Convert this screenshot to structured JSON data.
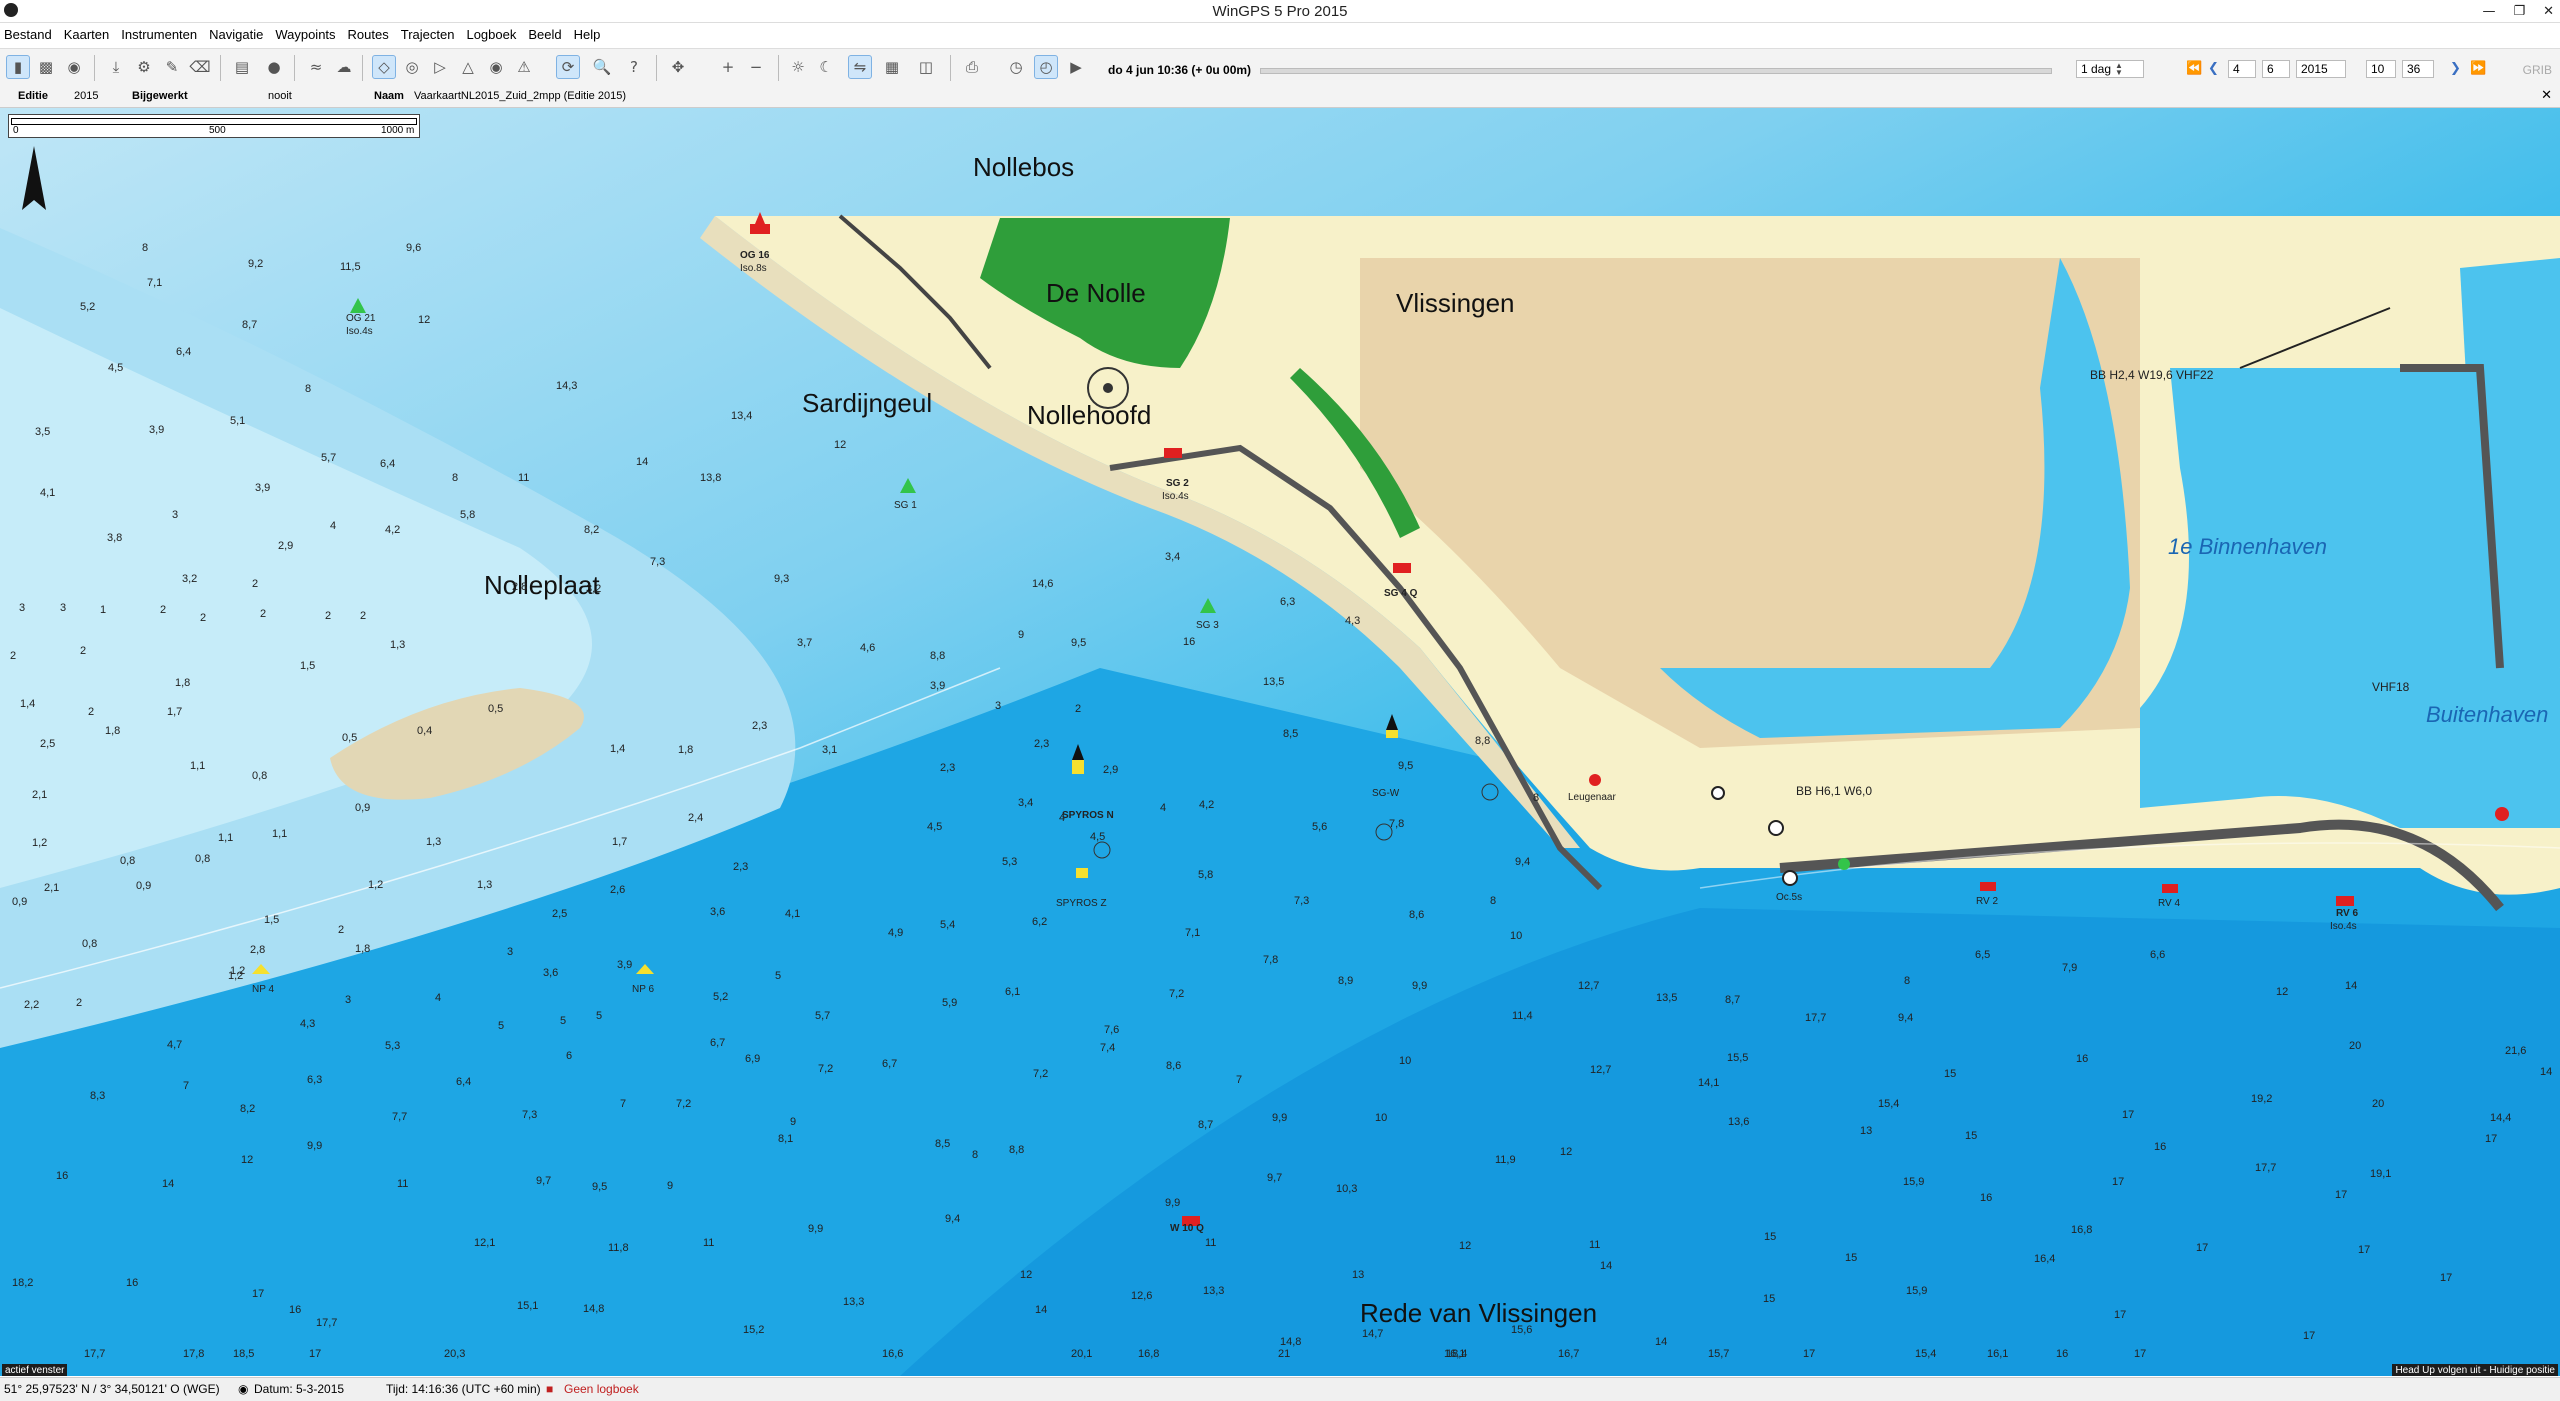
{
  "window": {
    "title": "WinGPS 5 Pro 2015"
  },
  "menu": [
    "Bestand",
    "Kaarten",
    "Instrumenten",
    "Navigatie",
    "Waypoints",
    "Routes",
    "Trajecten",
    "Logboek",
    "Beeld",
    "Help"
  ],
  "toolbar": {
    "datetime_label": "do 4 jun 10:36 (+ 0u 00m)",
    "step": "1 dag",
    "day": "4",
    "month": "6",
    "year": "2015",
    "hour": "10",
    "minute": "36",
    "grib": "GRIB"
  },
  "chartinfo": {
    "edition_label": "Editie",
    "edition": "2015",
    "updated_label": "Bijgewerkt",
    "updated": "nooit",
    "name_label": "Naam",
    "name": "VaarkaartNL2015_Zuid_2mpp (Editie 2015)"
  },
  "map": {
    "scale": {
      "s0": "0",
      "s1": "500",
      "s2": "1000 m"
    },
    "places": {
      "nollebos": "Nollebos",
      "denolle": "De Nolle",
      "vlissingen": "Vlissingen",
      "sardijngeul": "Sardijngeul",
      "nollehoofd": "Nollehoofd",
      "nolleplaat": "Nolleplaat",
      "binnenhaven": "1e Binnenhaven",
      "buitenhaven": "Buitenhaven",
      "rede": "Rede van Vlissingen"
    },
    "buoys": {
      "og16": "OG 16",
      "og16f": "Iso.8s",
      "og21": "OG 21",
      "og21f": "Iso.4s",
      "sg1": "SG 1",
      "sg2": "SG 2",
      "sg2f": "Iso.4s",
      "sg3": "SG 3",
      "sg4": "SG 4 Q",
      "sgw": "SG-W",
      "spyrosn": "SPYROS N",
      "spyrosz": "SPYROS Z",
      "np4": "NP 4",
      "np6": "NP 6",
      "w10": "W 10 Q",
      "rv2": "RV 2",
      "rv4": "RV 4",
      "rv6": "RV 6",
      "rv6f": "Iso.4s",
      "leugenaar": "Leugenaar",
      "bbh6": "BB H6,1 W6,0",
      "bbh24": "BB H2,4 W19,6 VHF22",
      "vhf18": "VHF18",
      "ocs": "Oc.5s"
    },
    "depths": [
      [
        "8",
        "142",
        "90"
      ],
      [
        "9,2",
        "248",
        "100"
      ],
      [
        "11,5",
        "340",
        "102"
      ],
      [
        "9,6",
        "406",
        "90"
      ],
      [
        "7,1",
        "147",
        "112"
      ],
      [
        "5,2",
        "80",
        "127"
      ],
      [
        "8,7",
        "242",
        "138"
      ],
      [
        "12",
        "418",
        "135"
      ],
      [
        "6,4",
        "176",
        "155"
      ],
      [
        "4,5",
        "108",
        "165"
      ],
      [
        "8",
        "305",
        "178"
      ],
      [
        "14,3",
        "556",
        "176"
      ],
      [
        "3,5",
        "35",
        "205"
      ],
      [
        "3,9",
        "149",
        "204"
      ],
      [
        "5,1",
        "230",
        "198"
      ],
      [
        "13,4",
        "731",
        "195"
      ],
      [
        "12",
        "834",
        "213"
      ],
      [
        "5,7",
        "321",
        "221"
      ],
      [
        "6,4",
        "380",
        "225"
      ],
      [
        "14",
        "636",
        "224"
      ],
      [
        "13,8",
        "700",
        "234"
      ],
      [
        "8",
        "452",
        "234"
      ],
      [
        "11",
        "518",
        "234"
      ],
      [
        "4,1",
        "40",
        "243"
      ],
      [
        "3,9",
        "255",
        "240"
      ],
      [
        "3",
        "172",
        "257"
      ],
      [
        "5,8",
        "460",
        "257"
      ],
      [
        "4",
        "330",
        "264"
      ],
      [
        "4,2",
        "385",
        "266"
      ],
      [
        "8,2",
        "584",
        "266"
      ],
      [
        "3,8",
        "107",
        "271"
      ],
      [
        "2,9",
        "278",
        "276"
      ],
      [
        "7,3",
        "650",
        "286"
      ],
      [
        "3,2",
        "182",
        "297"
      ],
      [
        "2",
        "252",
        "300"
      ],
      [
        "2,8",
        "512",
        "302"
      ],
      [
        "9,3",
        "774",
        "297"
      ],
      [
        "3",
        "19",
        "315"
      ],
      [
        "3",
        "60",
        "315"
      ],
      [
        "1",
        "100",
        "316"
      ],
      [
        "2",
        "160",
        "316"
      ],
      [
        "2",
        "200",
        "321"
      ],
      [
        "2",
        "260",
        "319"
      ],
      [
        "2",
        "325",
        "320"
      ],
      [
        "2",
        "360",
        "320"
      ],
      [
        "3,2",
        "586",
        "303"
      ],
      [
        "4,6",
        "860",
        "340"
      ],
      [
        "3,7",
        "797",
        "337"
      ],
      [
        "8,8",
        "930",
        "345"
      ],
      [
        "14,6",
        "1032",
        "300"
      ],
      [
        "9",
        "1018",
        "332"
      ],
      [
        "9,5",
        "1071",
        "337"
      ],
      [
        "16",
        "1183",
        "336"
      ],
      [
        "6,3",
        "1280",
        "311"
      ],
      [
        "4,3",
        "1345",
        "323"
      ],
      [
        "13,5",
        "1263",
        "361"
      ],
      [
        "3,4",
        "1165",
        "283"
      ],
      [
        "2",
        "10",
        "345"
      ],
      [
        "1,3",
        "390",
        "338"
      ],
      [
        "1,5",
        "300",
        "351"
      ],
      [
        "2",
        "80",
        "342"
      ],
      [
        "1,8",
        "175",
        "362"
      ],
      [
        "1,7",
        "167",
        "380"
      ],
      [
        "1,4",
        "20",
        "375"
      ],
      [
        "2",
        "88",
        "380"
      ],
      [
        "2,5",
        "40",
        "400"
      ],
      [
        "1,8",
        "105",
        "392"
      ],
      [
        "0,5",
        "488",
        "378"
      ],
      [
        "0,5",
        "342",
        "396"
      ],
      [
        "0,4",
        "417",
        "392"
      ],
      [
        "3,9",
        "930",
        "364"
      ],
      [
        "3",
        "995",
        "376"
      ],
      [
        "2",
        "1075",
        "378"
      ],
      [
        "2,3",
        "752",
        "389"
      ],
      [
        "3,1",
        "822",
        "404"
      ],
      [
        "2,3",
        "1034",
        "400"
      ],
      [
        "2,9",
        "1103",
        "416"
      ],
      [
        "1,4",
        "610",
        "403"
      ],
      [
        "1,8",
        "678",
        "404"
      ],
      [
        "1,1",
        "190",
        "414"
      ],
      [
        "0,8",
        "252",
        "420"
      ],
      [
        "2,3",
        "940",
        "415"
      ],
      [
        "9,5",
        "1398",
        "414"
      ],
      [
        "8,5",
        "1283",
        "394"
      ],
      [
        "8,8",
        "1475",
        "398"
      ],
      [
        "2,1",
        "32",
        "432"
      ],
      [
        "0,9",
        "355",
        "440"
      ],
      [
        "2,4",
        "688",
        "446"
      ],
      [
        "3,4",
        "1018",
        "437"
      ],
      [
        "4",
        "1059",
        "446"
      ],
      [
        "4",
        "1160",
        "440"
      ],
      [
        "4,2",
        "1199",
        "438"
      ],
      [
        "4,5",
        "927",
        "452"
      ],
      [
        "8",
        "1533",
        "434"
      ],
      [
        "1,1",
        "272",
        "456"
      ],
      [
        "1,1",
        "218",
        "459"
      ],
      [
        "1,3",
        "426",
        "461"
      ],
      [
        "1,2",
        "32",
        "462"
      ],
      [
        "0,8",
        "195",
        "472"
      ],
      [
        "0,8",
        "120",
        "473"
      ],
      [
        "5,6",
        "1312",
        "452"
      ],
      [
        "7,8",
        "1389",
        "450"
      ],
      [
        "1,7",
        "612",
        "461"
      ],
      [
        "2,3",
        "733",
        "477"
      ],
      [
        "5,3",
        "1002",
        "474"
      ],
      [
        "5,8",
        "1198",
        "482"
      ],
      [
        "4,5",
        "1090",
        "458"
      ],
      [
        "9,4",
        "1515",
        "474"
      ],
      [
        "1,2",
        "368",
        "488"
      ],
      [
        "1,3",
        "477",
        "488"
      ],
      [
        "0,9",
        "136",
        "489"
      ],
      [
        "2,6",
        "610",
        "491"
      ],
      [
        "3,6",
        "710",
        "505"
      ],
      [
        "4,1",
        "785",
        "506"
      ],
      [
        "7,3",
        "1294",
        "498"
      ],
      [
        "8",
        "1490",
        "498"
      ],
      [
        "0,9",
        "12",
        "499"
      ],
      [
        "2,1",
        "44",
        "490"
      ],
      [
        "6,2",
        "1032",
        "511"
      ],
      [
        "8,6",
        "1409",
        "507"
      ],
      [
        "7,1",
        "1185",
        "518"
      ],
      [
        "10",
        "1510",
        "520"
      ],
      [
        "1,5",
        "264",
        "510"
      ],
      [
        "2",
        "338",
        "516"
      ],
      [
        "2,5",
        "552",
        "506"
      ],
      [
        "4,9",
        "888",
        "518"
      ],
      [
        "5,4",
        "940",
        "513"
      ],
      [
        "0,8",
        "82",
        "525"
      ],
      [
        "1,8",
        "355",
        "528"
      ],
      [
        "2,8",
        "250",
        "529"
      ],
      [
        "3",
        "507",
        "530"
      ],
      [
        "3,9",
        "617",
        "538"
      ],
      [
        "7,8",
        "1263",
        "535"
      ],
      [
        "1,2",
        "230",
        "542"
      ],
      [
        "1,2",
        "228",
        "545"
      ],
      [
        "3,6",
        "543",
        "543"
      ],
      [
        "5",
        "775",
        "545"
      ],
      [
        "8,9",
        "1338",
        "548"
      ],
      [
        "9,9",
        "1412",
        "551"
      ],
      [
        "12,7",
        "1578",
        "551"
      ],
      [
        "13,5",
        "1656",
        "559"
      ],
      [
        "8,7",
        "1725",
        "560"
      ],
      [
        "8",
        "1904",
        "548"
      ],
      [
        "6,5",
        "1975",
        "532"
      ],
      [
        "2,2",
        "24",
        "563"
      ],
      [
        "2",
        "76",
        "562"
      ],
      [
        "3",
        "345",
        "560"
      ],
      [
        "4",
        "435",
        "559"
      ],
      [
        "5,2",
        "713",
        "558"
      ],
      [
        "6,1",
        "1005",
        "555"
      ],
      [
        "7,2",
        "1169",
        "556"
      ],
      [
        "5,9",
        "942",
        "562"
      ],
      [
        "5,7",
        "815",
        "570"
      ],
      [
        "17,7",
        "1805",
        "571"
      ],
      [
        "9,4",
        "1898",
        "571"
      ],
      [
        "11,4",
        "1512",
        "570"
      ],
      [
        "7,9",
        "2062",
        "540"
      ],
      [
        "12",
        "2276",
        "555"
      ],
      [
        "14",
        "2345",
        "551"
      ],
      [
        "6,6",
        "2150",
        "532"
      ],
      [
        "4,3",
        "300",
        "575"
      ],
      [
        "5",
        "498",
        "576"
      ],
      [
        "5",
        "560",
        "573"
      ],
      [
        "5",
        "596",
        "570"
      ],
      [
        "7,6",
        "1104",
        "579"
      ],
      [
        "6,7",
        "710",
        "587"
      ],
      [
        "5,3",
        "385",
        "589"
      ],
      [
        "6",
        "566",
        "595"
      ],
      [
        "4,7",
        "167",
        "588"
      ],
      [
        "6,3",
        "307",
        "610"
      ],
      [
        "6,4",
        "456",
        "611"
      ],
      [
        "6,9",
        "745",
        "597"
      ],
      [
        "7,2",
        "818",
        "603"
      ],
      [
        "6,7",
        "882",
        "600"
      ],
      [
        "8,6",
        "1166",
        "601"
      ],
      [
        "7,4",
        "1100",
        "590"
      ],
      [
        "10",
        "1399",
        "598"
      ],
      [
        "15,5",
        "1727",
        "596"
      ],
      [
        "16",
        "2076",
        "597"
      ],
      [
        "20",
        "2349",
        "589"
      ],
      [
        "21,6",
        "2505",
        "592"
      ],
      [
        "7",
        "183",
        "614"
      ],
      [
        "8,3",
        "90",
        "620"
      ],
      [
        "7,2",
        "1033",
        "606"
      ],
      [
        "12,7",
        "1590",
        "604"
      ],
      [
        "14,1",
        "1698",
        "612"
      ],
      [
        "15,4",
        "1878",
        "625"
      ],
      [
        "15",
        "1944",
        "606"
      ],
      [
        "17",
        "2122",
        "632"
      ],
      [
        "19,2",
        "2251",
        "622"
      ],
      [
        "20",
        "2372",
        "625"
      ],
      [
        "14",
        "2540",
        "605"
      ],
      [
        "8,2",
        "240",
        "628"
      ],
      [
        "7,7",
        "392",
        "633"
      ],
      [
        "7,3",
        "522",
        "632"
      ],
      [
        "7",
        "620",
        "625"
      ],
      [
        "7,2",
        "676",
        "625"
      ],
      [
        "9",
        "790",
        "636"
      ],
      [
        "7",
        "1236",
        "610"
      ],
      [
        "8,7",
        "1198",
        "638"
      ],
      [
        "9,9",
        "1272",
        "634"
      ],
      [
        "10",
        "1375",
        "634"
      ],
      [
        "13,6",
        "1728",
        "636"
      ],
      [
        "13",
        "1860",
        "642"
      ],
      [
        "15",
        "1965",
        "645"
      ],
      [
        "16",
        "2154",
        "652"
      ],
      [
        "17,7",
        "2255",
        "665"
      ],
      [
        "19,1",
        "2370",
        "669"
      ],
      [
        "14,4",
        "2490",
        "634"
      ],
      [
        "12",
        "241",
        "660"
      ],
      [
        "9,9",
        "307",
        "651"
      ],
      [
        "8,1",
        "778",
        "647"
      ],
      [
        "8,5",
        "935",
        "650"
      ],
      [
        "8",
        "972",
        "657"
      ],
      [
        "8,8",
        "1009",
        "654"
      ],
      [
        "11,9",
        "1495",
        "660"
      ],
      [
        "12",
        "1560",
        "655"
      ],
      [
        "17",
        "2485",
        "647"
      ],
      [
        "16",
        "56",
        "670"
      ],
      [
        "14",
        "162",
        "675"
      ],
      [
        "11",
        "397",
        "675"
      ],
      [
        "9,7",
        "536",
        "673"
      ],
      [
        "9,5",
        "592",
        "677"
      ],
      [
        "9",
        "667",
        "676"
      ],
      [
        "9,7",
        "1267",
        "671"
      ],
      [
        "10,3",
        "1336",
        "678"
      ],
      [
        "15,9",
        "1903",
        "674"
      ],
      [
        "17",
        "2112",
        "674"
      ],
      [
        "16",
        "1980",
        "684"
      ],
      [
        "17",
        "2335",
        "682"
      ],
      [
        "9,9",
        "1165",
        "687"
      ],
      [
        "9,4",
        "945",
        "697"
      ],
      [
        "9,9",
        "808",
        "703"
      ],
      [
        "11",
        "1205",
        "712"
      ],
      [
        "12",
        "1459",
        "714"
      ],
      [
        "11",
        "1589",
        "713"
      ],
      [
        "16,8",
        "2071",
        "704"
      ],
      [
        "17",
        "2196",
        "715"
      ],
      [
        "17",
        "2358",
        "716"
      ],
      [
        "12,1",
        "474",
        "712"
      ],
      [
        "11,8",
        "608",
        "715"
      ],
      [
        "11",
        "703",
        "712"
      ],
      [
        "12",
        "1020",
        "732"
      ],
      [
        "18,2",
        "12",
        "737"
      ],
      [
        "16",
        "126",
        "737"
      ],
      [
        "13",
        "1352",
        "732"
      ],
      [
        "14",
        "1600",
        "726"
      ],
      [
        "15",
        "1764",
        "708"
      ],
      [
        "15,9",
        "1906",
        "742"
      ],
      [
        "15",
        "1845",
        "721"
      ],
      [
        "16,4",
        "2034",
        "722"
      ],
      [
        "17",
        "2440",
        "734"
      ],
      [
        "17",
        "252",
        "744"
      ],
      [
        "16",
        "289",
        "754"
      ],
      [
        "15,1",
        "517",
        "751"
      ],
      [
        "14,8",
        "583",
        "753"
      ],
      [
        "13,3",
        "843",
        "749"
      ],
      [
        "14",
        "1035",
        "754"
      ],
      [
        "12,6",
        "1131",
        "745"
      ],
      [
        "13,3",
        "1203",
        "742"
      ],
      [
        "15,6",
        "1511",
        "766"
      ],
      [
        "17,7",
        "316",
        "762"
      ],
      [
        "15,2",
        "743",
        "766"
      ],
      [
        "14",
        "1655",
        "774"
      ],
      [
        "15",
        "1763",
        "747"
      ],
      [
        "17",
        "2114",
        "757"
      ],
      [
        "17",
        "2303",
        "770"
      ],
      [
        "14,7",
        "1362",
        "769"
      ],
      [
        "14,8",
        "1280",
        "774"
      ],
      [
        "16,1",
        "1444",
        "781"
      ],
      [
        "16,6",
        "882",
        "786"
      ],
      [
        "16,8",
        "1138",
        "788"
      ],
      [
        "15,7",
        "1708",
        "793"
      ],
      [
        "15,4",
        "1915",
        "795"
      ],
      [
        "16",
        "2056",
        "812"
      ],
      [
        "17,8",
        "183",
        "794"
      ],
      [
        "17",
        "309",
        "805"
      ],
      [
        "17,7",
        "84",
        "806"
      ],
      [
        "16,7",
        "1558",
        "804"
      ],
      [
        "18,4",
        "1446",
        "816"
      ],
      [
        "17",
        "1803",
        "822"
      ],
      [
        "16,1",
        "1987",
        "812"
      ],
      [
        "18,5",
        "233",
        "830"
      ],
      [
        "20,3",
        "444",
        "826"
      ],
      [
        "20,1",
        "1071",
        "823"
      ],
      [
        "21",
        "1278",
        "818"
      ],
      [
        "17",
        "2134",
        "836"
      ]
    ],
    "corner_left": "actief venster",
    "corner_right": "Head Up volgen uit - Huidige positie"
  },
  "status": {
    "position": "51° 25,97523' N / 3° 34,50121' O (WGE)",
    "datum": "Datum: 5-3-2015",
    "time": "Tijd: 14:16:36 (UTC +60 min)",
    "logbook": "Geen logboek"
  }
}
